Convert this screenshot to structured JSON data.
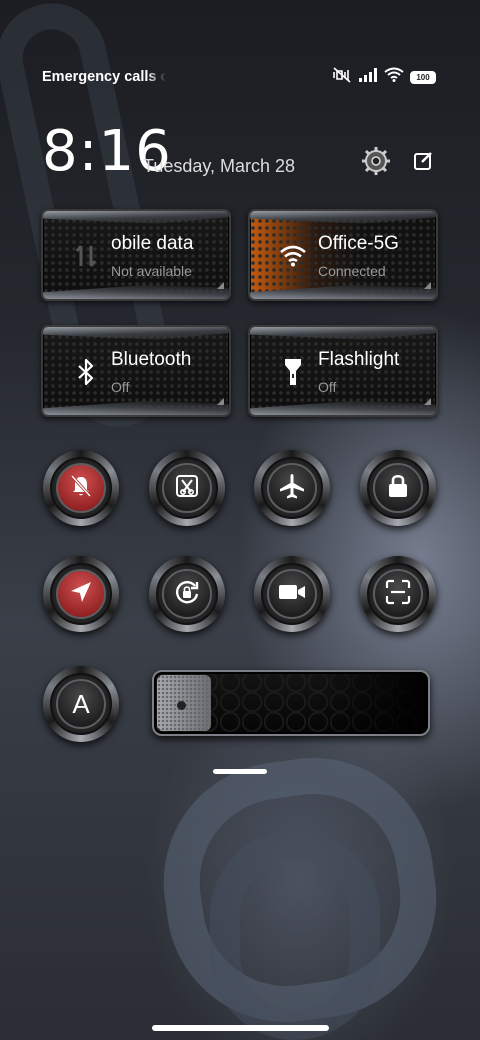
{
  "status_bar": {
    "carrier": "Emergency calls o",
    "battery": "100",
    "icons": [
      "mute-vibrate-icon",
      "signal-icon",
      "wifi-icon",
      "battery-icon"
    ]
  },
  "header": {
    "time": "8:16",
    "date": "Tuesday, March 28"
  },
  "tiles": [
    {
      "label": "obile data",
      "sub": "Not available",
      "icon": "mobile-data-icon",
      "active": false
    },
    {
      "label": "Office-5G",
      "sub": "Connected",
      "icon": "wifi-icon",
      "active": true
    },
    {
      "label": "Bluetooth",
      "sub": "Off",
      "icon": "bluetooth-icon",
      "active": false
    },
    {
      "label": "Flashlight",
      "sub": "Off",
      "icon": "flashlight-icon",
      "active": false
    }
  ],
  "toggles_row1": [
    {
      "name": "mute",
      "icon": "bell-off-icon",
      "on": true
    },
    {
      "name": "screenshot",
      "icon": "scissors-icon",
      "on": false
    },
    {
      "name": "airplane-mode",
      "icon": "airplane-icon",
      "on": false
    },
    {
      "name": "lock-screen",
      "icon": "lock-icon",
      "on": false
    }
  ],
  "toggles_row2": [
    {
      "name": "location",
      "icon": "location-arrow-icon",
      "on": true
    },
    {
      "name": "rotation-lock",
      "icon": "rotation-lock-icon",
      "on": false
    },
    {
      "name": "screen-recorder",
      "icon": "video-camera-icon",
      "on": false
    },
    {
      "name": "scanner",
      "icon": "scan-icon",
      "on": false
    }
  ],
  "auto_brightness": {
    "label": "A",
    "icon": "auto-brightness-icon"
  },
  "brightness": {
    "level": 0.2
  },
  "colors": {
    "active_red": "#b02a2a",
    "wifi_accent": "#c85a0e"
  }
}
